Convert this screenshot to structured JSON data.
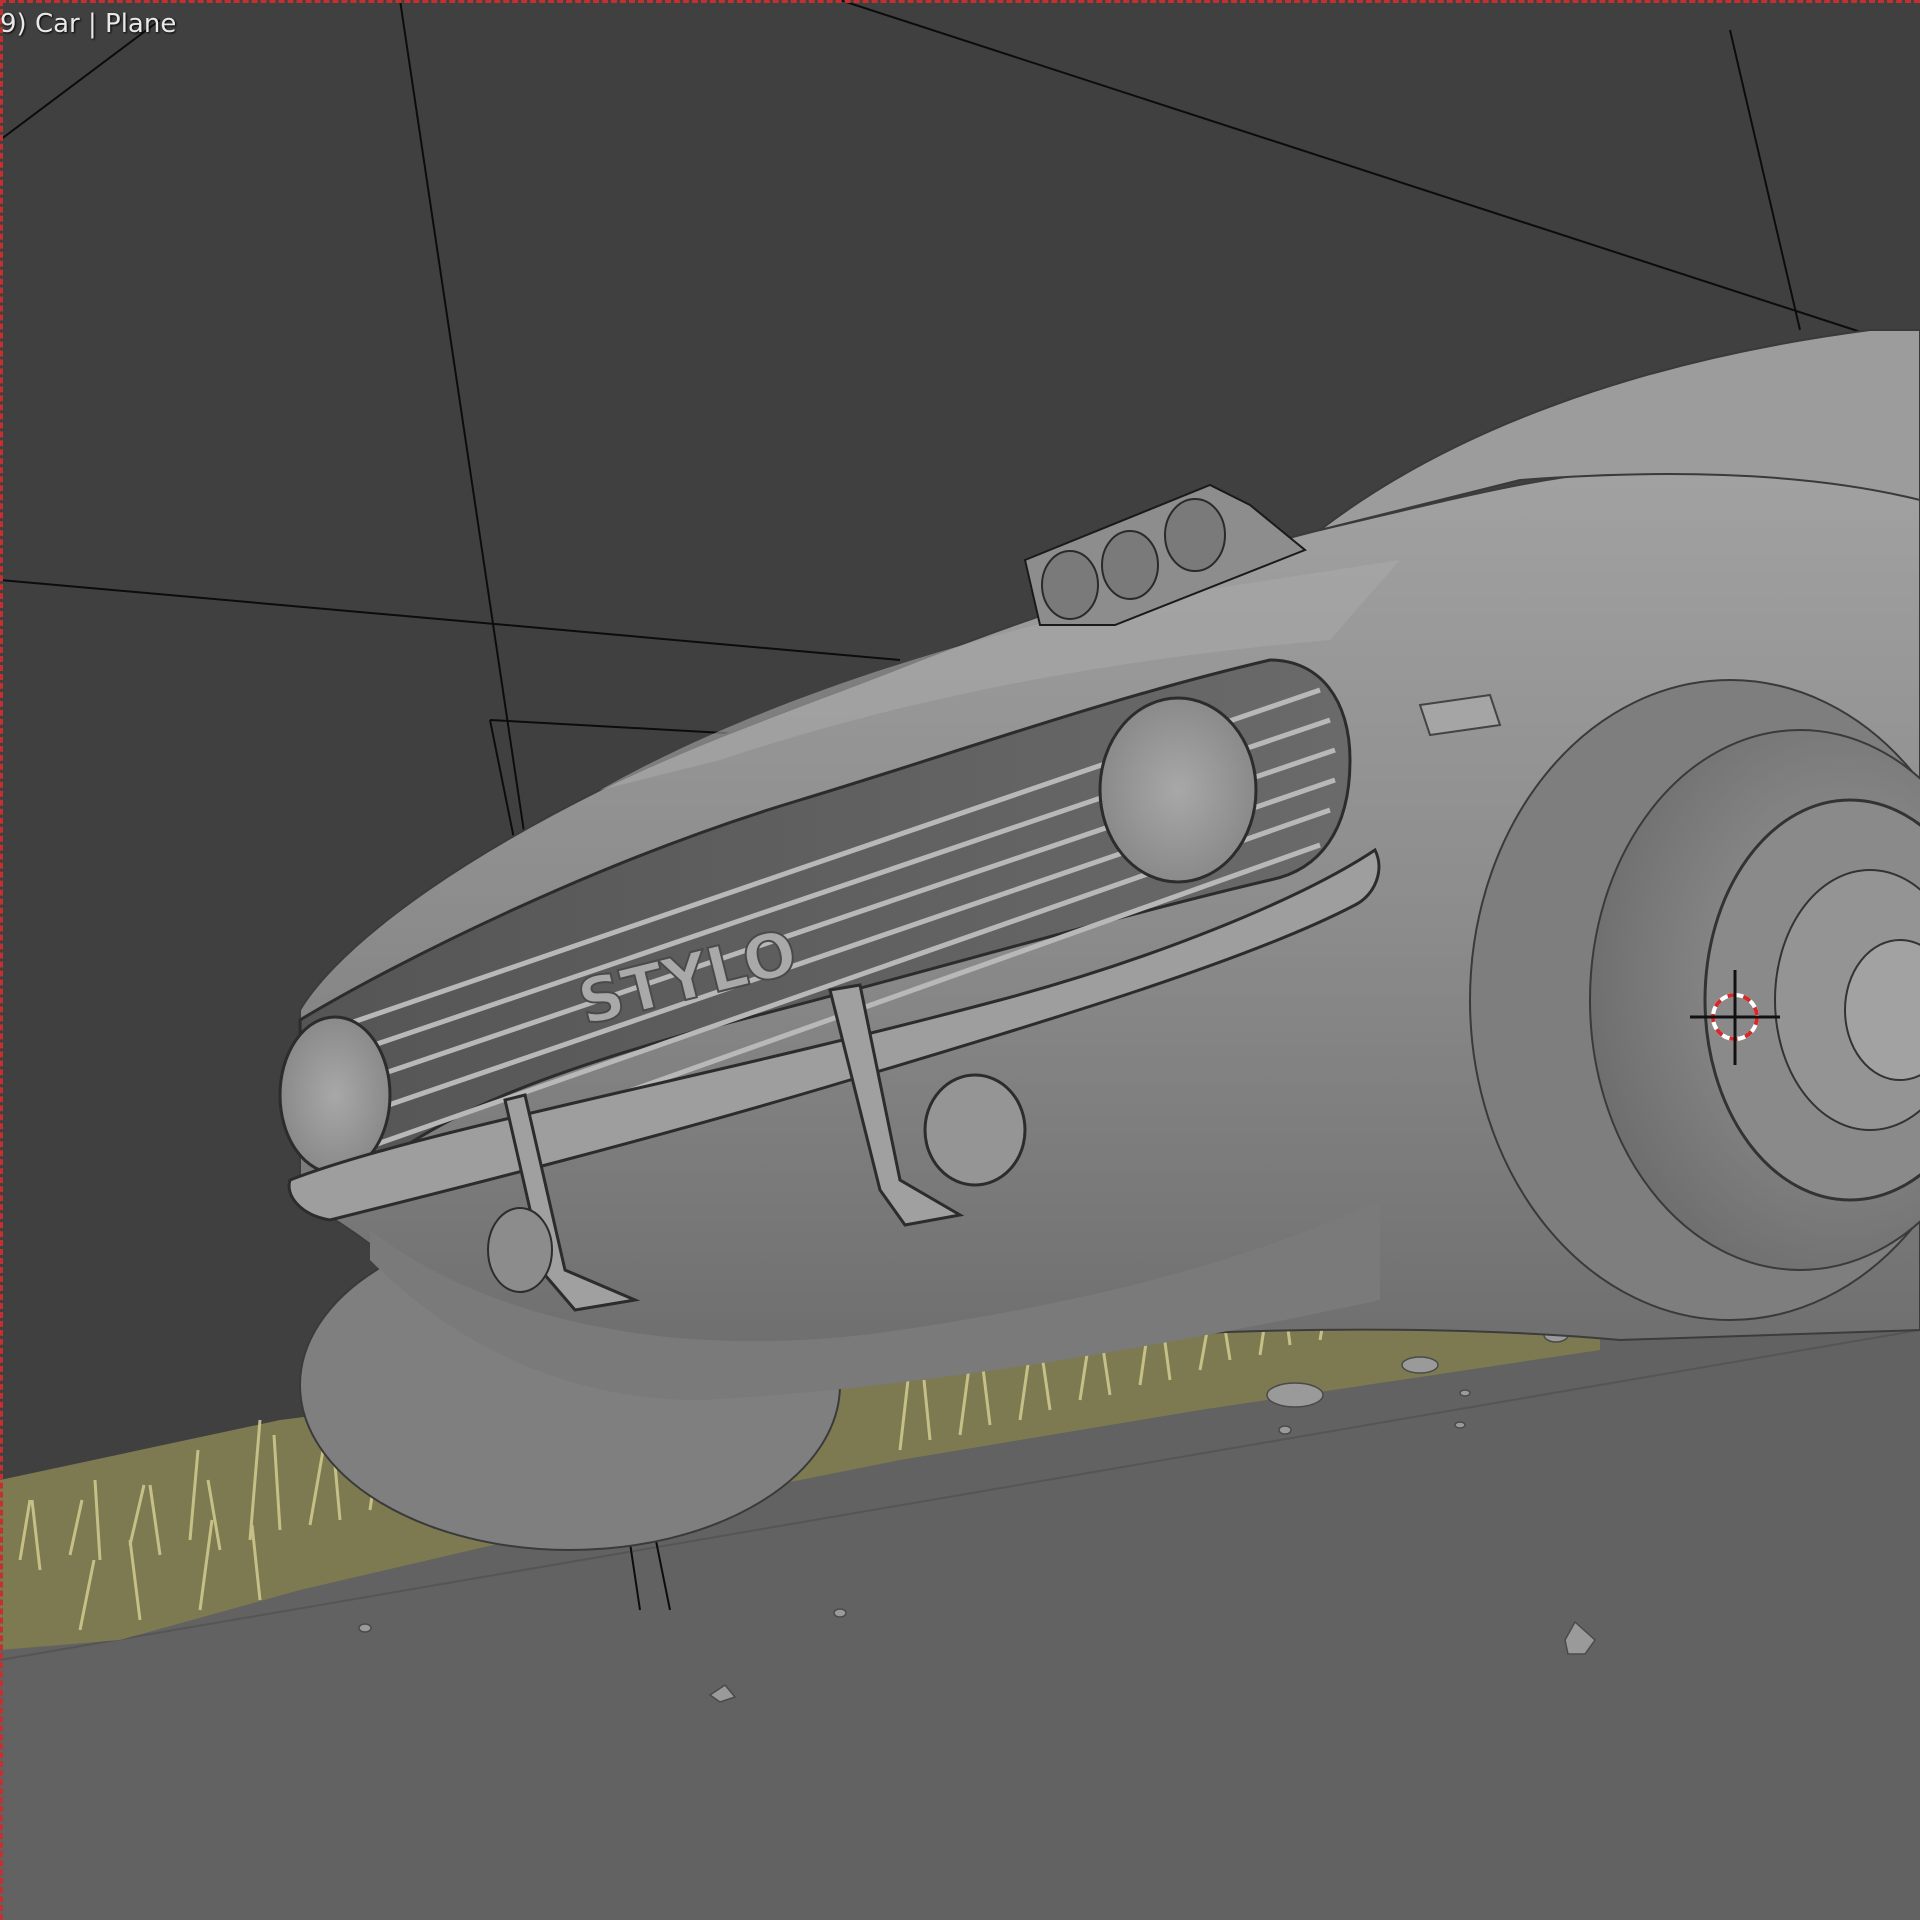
{
  "viewport": {
    "object_info": "9) Car | Plane",
    "colors": {
      "background": "#404040",
      "ground": "#616161",
      "car_body": "#8a8a8a",
      "grass": "#c2bd7e",
      "frame_dash": "#c23030",
      "cursor_red": "#d42a2a"
    }
  },
  "car": {
    "grille_badge": "STYLO"
  }
}
